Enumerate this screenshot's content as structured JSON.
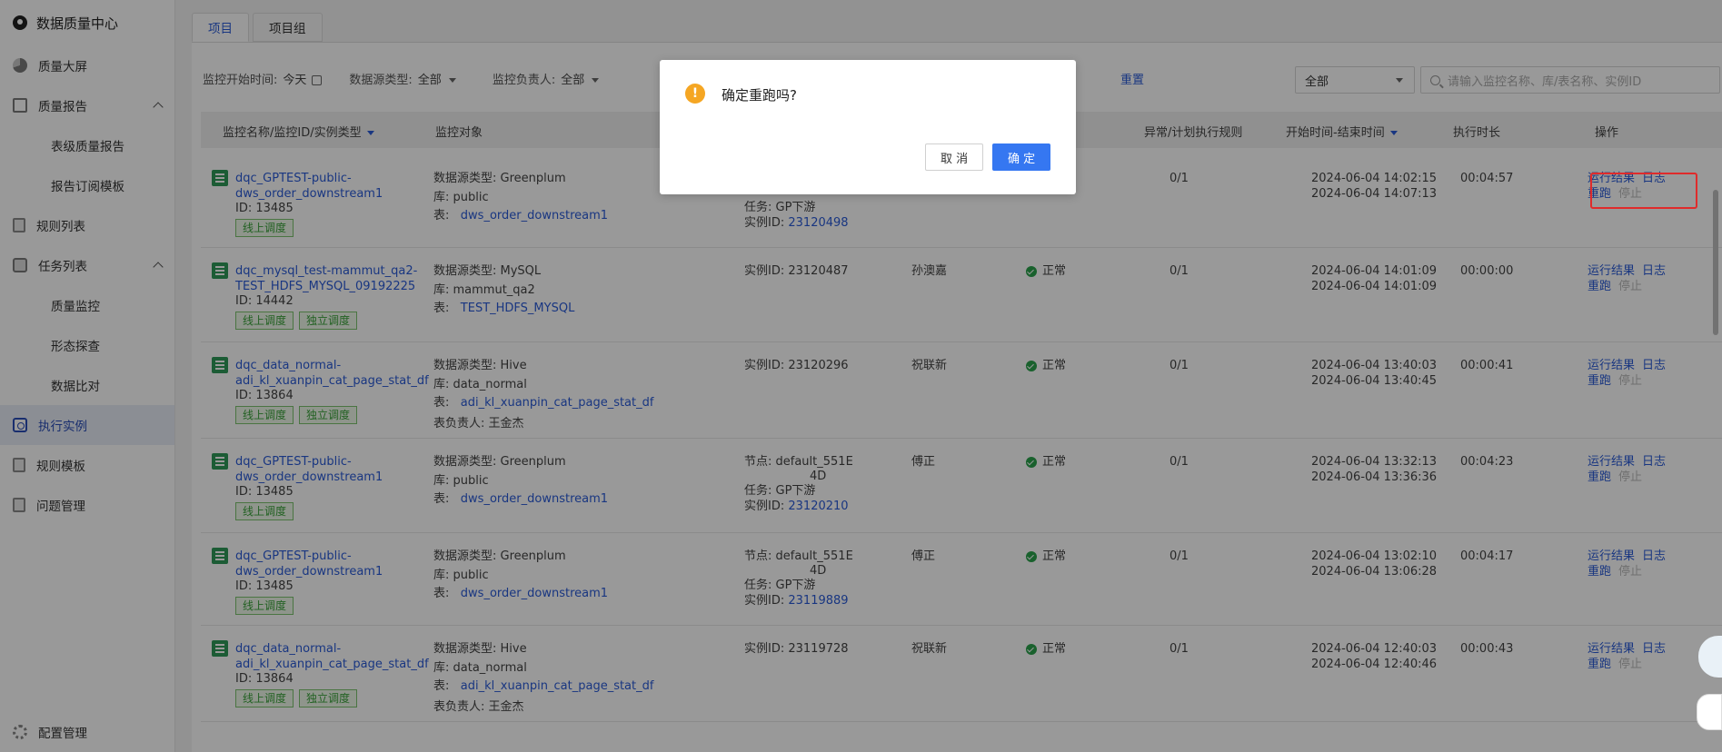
{
  "app": {
    "title": "数据质量中心"
  },
  "sidebar": {
    "items": [
      {
        "label": "质量大屏",
        "icon": "dashboard-pie-icon"
      },
      {
        "label": "质量报告",
        "icon": "report-icon"
      },
      {
        "label": "表级质量报告"
      },
      {
        "label": "报告订阅模板"
      },
      {
        "label": "规则列表",
        "icon": "rule-list-icon"
      },
      {
        "label": "任务列表",
        "icon": "task-list-icon"
      },
      {
        "label": "质量监控"
      },
      {
        "label": "形态探查"
      },
      {
        "label": "数据比对"
      },
      {
        "label": "执行实例",
        "icon": "exec-instance-icon"
      },
      {
        "label": "规则模板",
        "icon": "rule-template-icon"
      },
      {
        "label": "问题管理",
        "icon": "issue-icon"
      }
    ],
    "bottom": {
      "label": "配置管理"
    }
  },
  "tabs": [
    "项目",
    "项目组"
  ],
  "filters": {
    "start_time_label": "监控开始时间:",
    "start_time_value": "今天",
    "ds_type_label": "数据源类型:",
    "ds_type_value": "全部",
    "owner_label": "监控负责人:",
    "owner_value": "全部",
    "reset": "重置",
    "status_select": "全部",
    "search_placeholder": "请输入监控名称、库/表名称、实例ID"
  },
  "columns": {
    "name": "监控名称/监控ID/实例类型",
    "object": "监控对象",
    "rules": "异常/计划执行规则",
    "time": "开始时间-结束时间",
    "duration": "执行时长",
    "ops": "操作"
  },
  "rows": [
    {
      "name1": "dqc_GPTEST-public-",
      "name2": "dws_order_downstream1",
      "id": "ID: 13485",
      "badges": [
        "线上调度"
      ],
      "ds": "数据源类型: Greenplum",
      "db": "库:   public",
      "tbl_label": "表:",
      "tbl": "dws_order_downstream1",
      "extra": "",
      "inst1": "任务:    GP下游",
      "inst2_label": "实例ID:",
      "inst2": "23120498",
      "inst0": "",
      "owner": "",
      "status": "",
      "rules": "0/1",
      "t1": "2024-06-04 14:02:15",
      "t2": "2024-06-04 14:07:13",
      "dur": "00:04:57"
    },
    {
      "name1": "dqc_mysql_test-mammut_qa2-",
      "name2": "TEST_HDFS_MYSQL_09192225",
      "id": "ID: 14442",
      "badges": [
        "线上调度",
        "独立调度"
      ],
      "ds": "数据源类型: MySQL",
      "db": "库:   mammut_qa2",
      "tbl_label": "表:",
      "tbl": "TEST_HDFS_MYSQL",
      "extra": "",
      "inst0": "实例ID:   23120487",
      "inst1": "",
      "inst2_label": "",
      "inst2": "",
      "owner": "孙澳嘉",
      "status": "正常",
      "rules": "0/1",
      "t1": "2024-06-04 14:01:09",
      "t2": "2024-06-04 14:01:09",
      "dur": "00:00:00"
    },
    {
      "name1": "dqc_data_normal-",
      "name2": "adi_kl_xuanpin_cat_page_stat_df",
      "id": "ID: 13864",
      "badges": [
        "线上调度",
        "独立调度"
      ],
      "ds": "数据源类型: Hive",
      "db": "库:   data_normal",
      "tbl_label": "表:",
      "tbl": "adi_kl_xuanpin_cat_page_stat_df",
      "extra": "表负责人:   王金杰",
      "inst0": "实例ID:   23120296",
      "inst1": "",
      "inst2_label": "",
      "inst2": "",
      "owner": "祝联新",
      "status": "正常",
      "rules": "0/1",
      "t1": "2024-06-04 13:40:03",
      "t2": "2024-06-04 13:40:45",
      "dur": "00:00:41"
    },
    {
      "name1": "dqc_GPTEST-public-",
      "name2": "dws_order_downstream1",
      "id": "ID: 13485",
      "badges": [
        "线上调度"
      ],
      "ds": "数据源类型: Greenplum",
      "db": "库:   public",
      "tbl_label": "表:",
      "tbl": "dws_order_downstream1",
      "extra": "",
      "inst0": "节点:   default_551E",
      "inst0b": "4D",
      "inst1": "任务:    GP下游",
      "inst2_label": "实例ID:",
      "inst2": "23120210",
      "owner": "傅正",
      "status": "正常",
      "rules": "0/1",
      "t1": "2024-06-04 13:32:13",
      "t2": "2024-06-04 13:36:36",
      "dur": "00:04:23"
    },
    {
      "name1": "dqc_GPTEST-public-",
      "name2": "dws_order_downstream1",
      "id": "ID: 13485",
      "badges": [
        "线上调度"
      ],
      "ds": "数据源类型: Greenplum",
      "db": "库:   public",
      "tbl_label": "表:",
      "tbl": "dws_order_downstream1",
      "extra": "",
      "inst0": "节点:   default_551E",
      "inst0b": "4D",
      "inst1": "任务:    GP下游",
      "inst2_label": "实例ID:",
      "inst2": "23119889",
      "owner": "傅正",
      "status": "正常",
      "rules": "0/1",
      "t1": "2024-06-04 13:02:10",
      "t2": "2024-06-04 13:06:28",
      "dur": "00:04:17"
    },
    {
      "name1": "dqc_data_normal-",
      "name2": "adi_kl_xuanpin_cat_page_stat_df",
      "id": "ID: 13864",
      "badges": [
        "线上调度",
        "独立调度"
      ],
      "ds": "数据源类型: Hive",
      "db": "库:   data_normal",
      "tbl_label": "表:",
      "tbl": "adi_kl_xuanpin_cat_page_stat_df",
      "extra": "表负责人:   王金杰",
      "inst0": "实例ID:   23119728",
      "inst1": "",
      "inst2_label": "",
      "inst2": "",
      "owner": "祝联新",
      "status": "正常",
      "rules": "0/1",
      "t1": "2024-06-04 12:40:03",
      "t2": "2024-06-04 12:40:46",
      "dur": "00:00:43"
    }
  ],
  "ops": {
    "result": "运行结果",
    "log": "日志",
    "rerun": "重跑",
    "stop": "停止"
  },
  "modal": {
    "title": "确定重跑吗?",
    "cancel": "取 消",
    "ok": "确 定"
  },
  "colors": {
    "accent": "#2a5bd7",
    "primary_button": "#3577f1",
    "warning": "#f5a623",
    "success": "#2ba24c",
    "highlight": "#e02b2b"
  }
}
